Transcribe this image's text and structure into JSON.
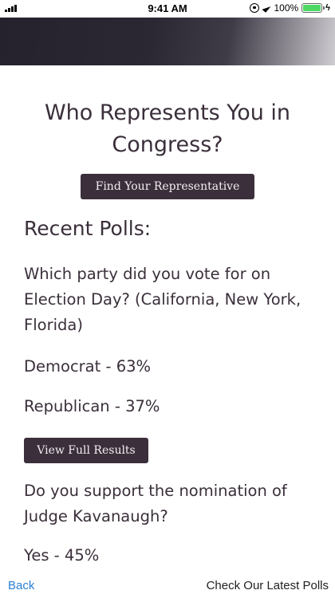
{
  "status_bar": {
    "time": "9:41 AM",
    "battery_percent_label": "100%",
    "battery_level": 1.0,
    "icons": [
      "signal-icon",
      "rotation-lock-icon",
      "location-icon",
      "battery-icon",
      "charging-icon"
    ]
  },
  "page": {
    "title": "Who Represents You in Congress?",
    "find_button": "Find Your Representative",
    "section_title": "Recent Polls:"
  },
  "polls": [
    {
      "question": "Which party did you vote for on Election Day? (California, New York, Florida)",
      "results": [
        {
          "label": "Democrat - 63%"
        },
        {
          "label": "Republican - 37%"
        }
      ],
      "button": "View Full Results"
    },
    {
      "question": "Do you support the nomination of Judge Kavanaugh?",
      "results": [
        {
          "label": "Yes - 45%"
        }
      ]
    }
  ],
  "bottom_bar": {
    "back": "Back",
    "latest": "Check Our Latest Polls"
  },
  "colors": {
    "button_bg": "#3b2f3b",
    "text": "#3a2f3a",
    "link": "#2a7fd4",
    "battery": "#4cd964"
  }
}
